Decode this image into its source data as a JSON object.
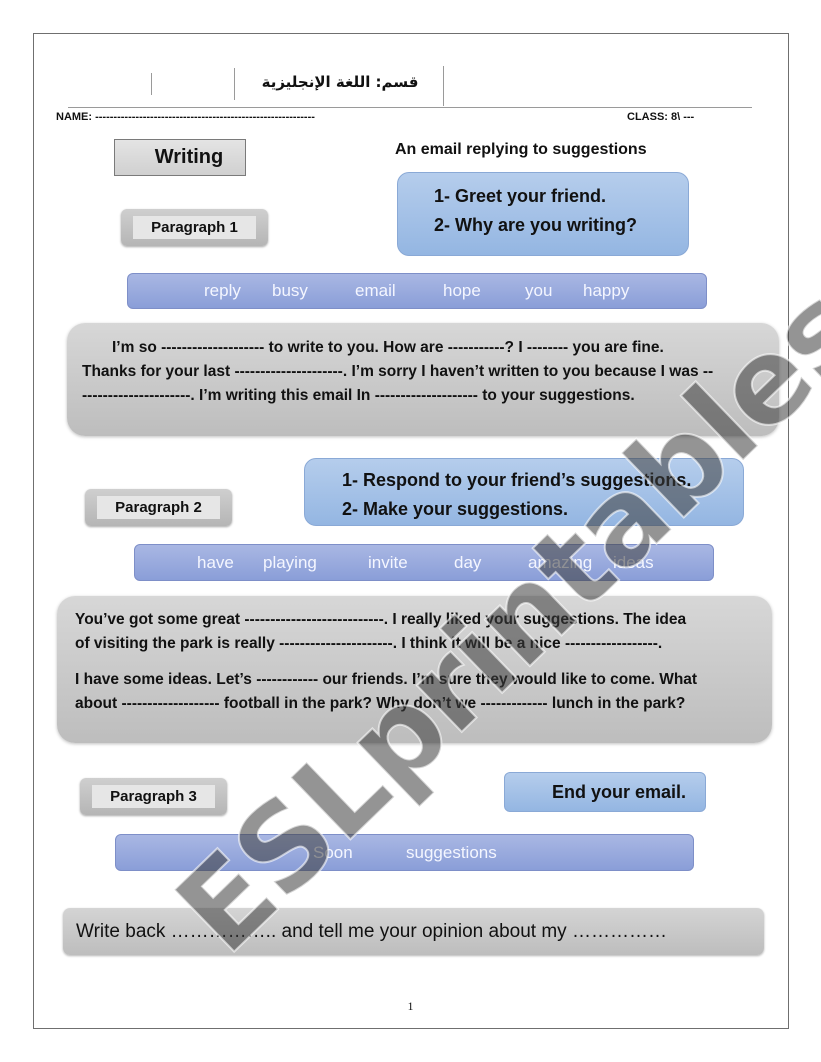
{
  "header": {
    "department_arabic": "قسم: اللغة الإنجليزية",
    "name_label": "NAME: ------------------------------------------------------------",
    "class_label": "CLASS: 8\\ ---"
  },
  "title": {
    "writing_label": "Writing",
    "subtitle": "An email replying to suggestions"
  },
  "paragraph1": {
    "label": "Paragraph 1",
    "tasks": [
      "1-  Greet your friend.",
      "2-  Why are you writing?"
    ],
    "word_bank": [
      "reply",
      "busy",
      "email",
      "hope",
      "you",
      "happy"
    ],
    "text_lines": [
      "I’m so -------------------- to write to you. How are -----------? I -------- you are fine.",
      "Thanks for your last ---------------------. I’m sorry I haven’t written to you because I was --",
      "---------------------. I’m writing this email In -------------------- to your suggestions."
    ]
  },
  "paragraph2": {
    "label": "Paragraph 2",
    "tasks": [
      "1-  Respond to your friend’s suggestions.",
      "2-  Make your suggestions."
    ],
    "word_bank": [
      "have",
      "playing",
      "invite",
      "day",
      "amazing",
      "ideas"
    ],
    "text_lines": [
      "You’ve got some great ---------------------------. I really liked your suggestions. The idea",
      "of visiting the park is really ----------------------. I think it will be a nice ------------------.",
      " I have some ideas. Let’s ------------ our friends. I’m sure they would like to come. What",
      "about ------------------- football in the park? Why don’t we ------------- lunch in the park?"
    ]
  },
  "paragraph3": {
    "label": "Paragraph 3",
    "task": "End your email.",
    "word_bank": [
      "Soon",
      "suggestions"
    ],
    "closing_text": "Write back …………….. and tell me your opinion about my ……………"
  },
  "footer": {
    "page_number": "1"
  },
  "watermark": "ESLprintables.com",
  "colors": {
    "task_box_blue": "#a5c2e8",
    "word_bank_blue": "#98aadd",
    "text_box_gray": "#c9c9c9"
  }
}
